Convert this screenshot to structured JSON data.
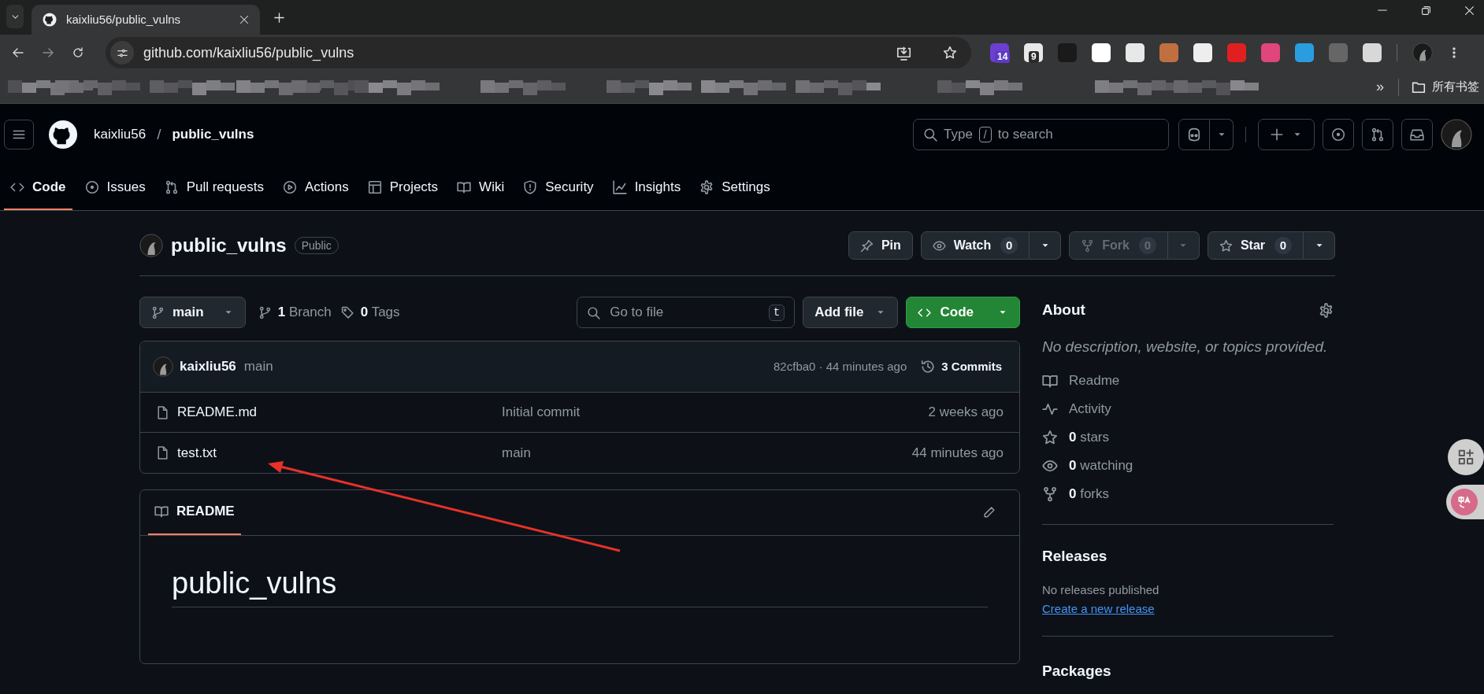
{
  "browser": {
    "tab_title": "kaixliu56/public_vulns",
    "url": "github.com/kaixliu56/public_vulns",
    "extension_badges": [
      {
        "badge": "14"
      },
      {
        "badge": "9"
      }
    ],
    "bookmarks_overflow": "»",
    "bookmarks_folder": "所有书签"
  },
  "header": {
    "owner": "kaixliu56",
    "separator": "/",
    "repo": "public_vulns",
    "search": {
      "before": "Type",
      "key": "/",
      "after": "to search"
    }
  },
  "nav_tabs": [
    {
      "label": "Code",
      "selected": true
    },
    {
      "label": "Issues",
      "selected": false
    },
    {
      "label": "Pull requests",
      "selected": false
    },
    {
      "label": "Actions",
      "selected": false
    },
    {
      "label": "Projects",
      "selected": false
    },
    {
      "label": "Wiki",
      "selected": false
    },
    {
      "label": "Security",
      "selected": false
    },
    {
      "label": "Insights",
      "selected": false
    },
    {
      "label": "Settings",
      "selected": false
    }
  ],
  "repo": {
    "name": "public_vulns",
    "visibility": "Public",
    "actions": [
      {
        "label": "Pin",
        "disabled": false
      },
      {
        "label": "Watch",
        "count": "0",
        "disabled": false,
        "dropdown": true
      },
      {
        "label": "Fork",
        "count": "0",
        "disabled": true,
        "dropdown": true
      },
      {
        "label": "Star",
        "count": "0",
        "disabled": false,
        "dropdown": true
      }
    ]
  },
  "toolbar": {
    "branch": "main",
    "branches": "**1** Branch",
    "tags": "**0** Tags",
    "go_to_file": {
      "placeholder": "Go to file",
      "key": "t"
    },
    "add_file": "Add file",
    "code": "Code"
  },
  "latest_commit": {
    "author": "kaixliu56",
    "message": "main",
    "hash_time": "82cfba0 · 44 minutes ago",
    "commits": "3 Commits"
  },
  "files": [
    {
      "name": "README.md",
      "message": "Initial commit",
      "time": "2 weeks ago"
    },
    {
      "name": "test.txt",
      "message": "main",
      "time": "44 minutes ago"
    }
  ],
  "readme": {
    "tab": "README",
    "heading": "public_vulns"
  },
  "about": {
    "title": "About",
    "description": "No description, website, or topics provided.",
    "items": [
      {
        "label": "Readme"
      },
      {
        "label": "Activity"
      },
      {
        "label": "**0** stars"
      },
      {
        "label": "**0** watching"
      },
      {
        "label": "**0** forks"
      }
    ]
  },
  "releases": {
    "title": "Releases",
    "note": "No releases published",
    "link": "Create a new release"
  },
  "packages": {
    "title": "Packages"
  }
}
